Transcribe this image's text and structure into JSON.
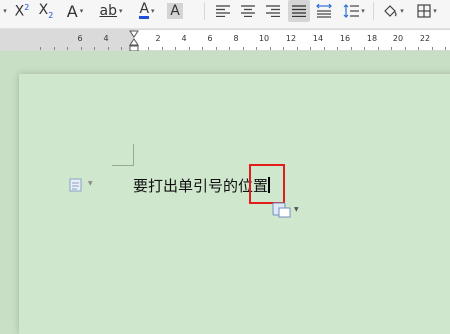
{
  "toolbar": {
    "superscript_label": "X",
    "superscript_exp": "2",
    "subscript_label": "X",
    "subscript_exp": "2",
    "text_effect_label": "A",
    "phonetic_label": "ab",
    "font_color_label": "A",
    "char_shading_label": "A",
    "font_color": "#1e4fd6"
  },
  "ruler": {
    "numbers": [
      "6",
      "4",
      "2",
      "2",
      "4",
      "6",
      "8",
      "10",
      "12",
      "14",
      "16",
      "18",
      "20",
      "22"
    ]
  },
  "document": {
    "text": "要打出单引号的位置"
  },
  "colors": {
    "highlight": "#e31c1c",
    "page_background": "#cfe7cc"
  }
}
